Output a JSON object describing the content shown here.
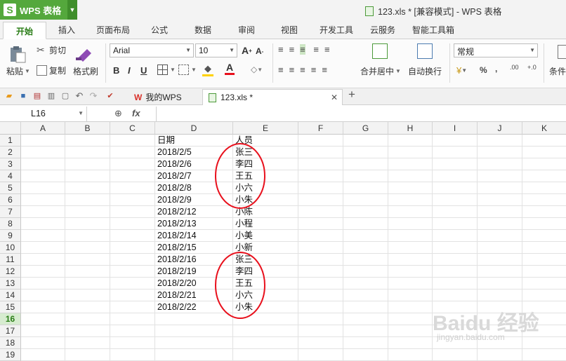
{
  "app": {
    "name": "WPS 表格",
    "logo_letter": "S",
    "window_title": "123.xls * [兼容模式] - WPS 表格"
  },
  "menu_tabs": [
    "开始",
    "插入",
    "页面布局",
    "公式",
    "数据",
    "审阅",
    "视图",
    "开发工具",
    "云服务",
    "智能工具箱"
  ],
  "ribbon": {
    "paste": "粘贴",
    "cut": "剪切",
    "copy": "复制",
    "format_painter": "格式刷",
    "font_name": "Arial",
    "font_size": "10",
    "merge_center": "合并居中",
    "wrap_text": "自动换行",
    "number_format": "常规",
    "percent": "%",
    "comma": ",",
    "condition": "条件",
    "inc_decimal": ".00",
    "dec_decimal": "+.0"
  },
  "doc_tabs": [
    {
      "label": "我的WPS",
      "icon": "wps-logo-icon"
    },
    {
      "label": "123.xls *",
      "icon": "sheet-icon",
      "active": true
    }
  ],
  "formula_bar": {
    "name_box": "L16",
    "fx": "fx"
  },
  "columns": [
    "A",
    "B",
    "C",
    "D",
    "E",
    "F",
    "G",
    "H",
    "I",
    "J",
    "K"
  ],
  "rows": [
    "1",
    "2",
    "3",
    "4",
    "5",
    "6",
    "7",
    "8",
    "9",
    "10",
    "11",
    "12",
    "13",
    "14",
    "15",
    "16",
    "17",
    "18",
    "19"
  ],
  "selected_row": "16",
  "cells": {
    "D": [
      "日期",
      "2018/2/5",
      "2018/2/6",
      "2018/2/7",
      "2018/2/8",
      "2018/2/9",
      "2018/2/12",
      "2018/2/13",
      "2018/2/14",
      "2018/2/15",
      "2018/2/16",
      "2018/2/19",
      "2018/2/20",
      "2018/2/21",
      "2018/2/22"
    ],
    "E": [
      "人员",
      "张三",
      "李四",
      "王五",
      "小六",
      "小朱",
      "小陈",
      "小程",
      "小美",
      "小新",
      "张三",
      "李四",
      "王五",
      "小六",
      "小朱"
    ]
  },
  "annotations": {
    "circle_color": "#e8101c"
  },
  "watermark": {
    "brand": "Baidu",
    "word": "经验",
    "url": "jingyan.baidu.com"
  },
  "colors": {
    "accent": "#54a83c",
    "selected_row": "#d7ecd0"
  }
}
